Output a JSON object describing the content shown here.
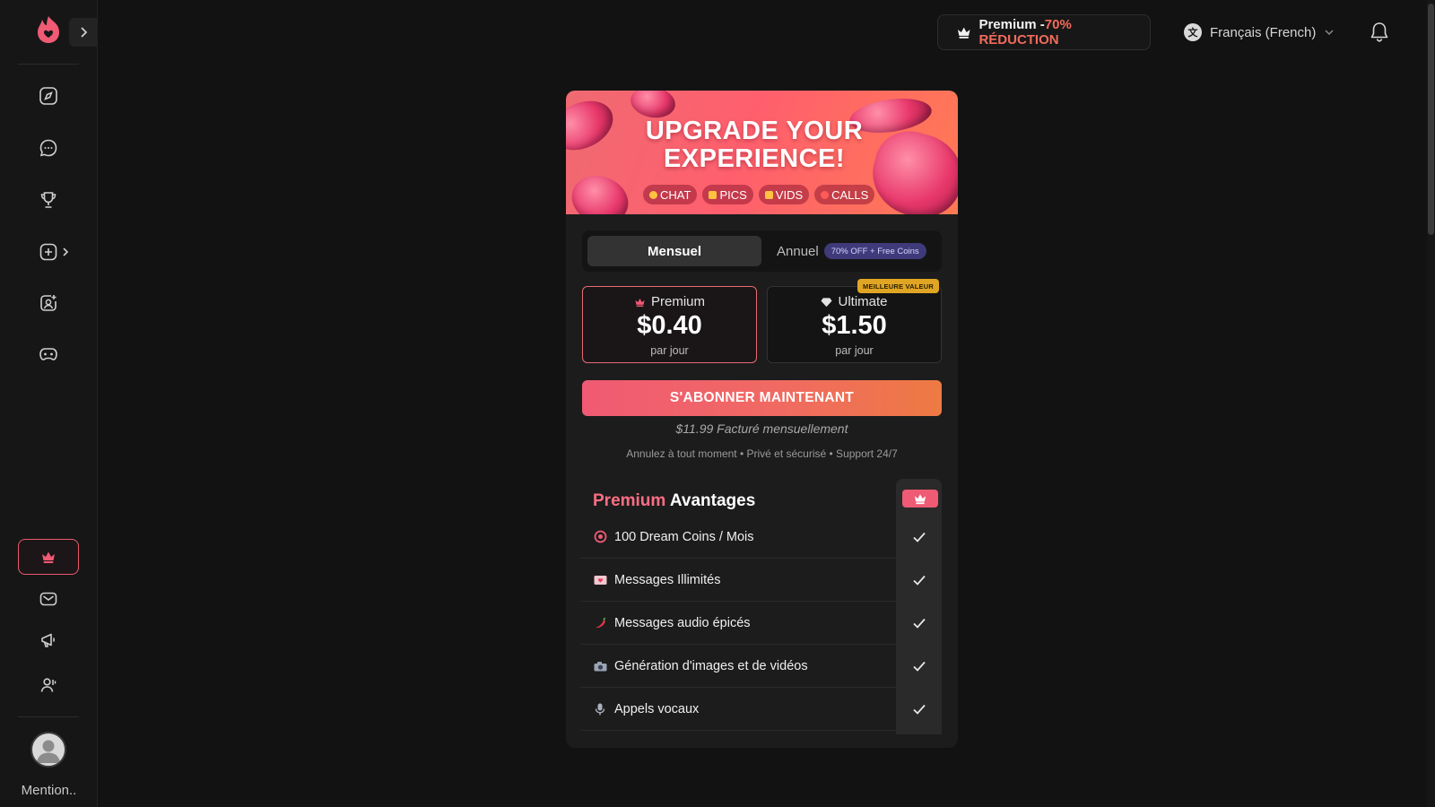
{
  "sidebar": {
    "nav_icons": [
      "compass-icon",
      "chat-bubble-icon",
      "trophy-icon",
      "add-square-icon",
      "image-add-icon",
      "gamepad-icon"
    ],
    "bottom_icons": [
      "crown-icon",
      "mail-icon",
      "megaphone-icon",
      "user-icon"
    ],
    "username": "Mention.."
  },
  "header": {
    "promo_prefix": "Premium -",
    "promo_highlight": "70% RÉDUCTION",
    "language": "Français (French)"
  },
  "banner": {
    "title_line1": "UPGRADE YOUR",
    "title_line2": "EXPERIENCE!",
    "chips": [
      "CHAT",
      "PICS",
      "VIDS",
      "CALLS"
    ]
  },
  "billing_toggle": {
    "monthly": "Mensuel",
    "annual": "Annuel",
    "annual_badge": "70% OFF + Free Coins"
  },
  "plans": [
    {
      "name": "Premium",
      "price": "$0.40",
      "per": "par jour",
      "selected": true
    },
    {
      "name": "Ultimate",
      "price": "$1.50",
      "per": "par jour",
      "badge": "MEILLEURE VALEUR"
    }
  ],
  "cta": "S'ABONNER MAINTENANT",
  "billed": "$11.99 Facturé mensuellement",
  "assurances": "Annulez à tout moment • Privé et sécurisé • Support 24/7",
  "benefits": {
    "title_accent": "Premium",
    "title_rest": "Avantages",
    "items": [
      "100 Dream Coins / Mois",
      "Messages Illimités",
      "Messages audio épicés",
      "Génération d'images et de vidéos",
      "Appels vocaux"
    ]
  },
  "colors": {
    "accent": "#ef5a74",
    "cta_end": "#ee7a43",
    "badge_gold": "#e0a623",
    "background": "#121212"
  }
}
